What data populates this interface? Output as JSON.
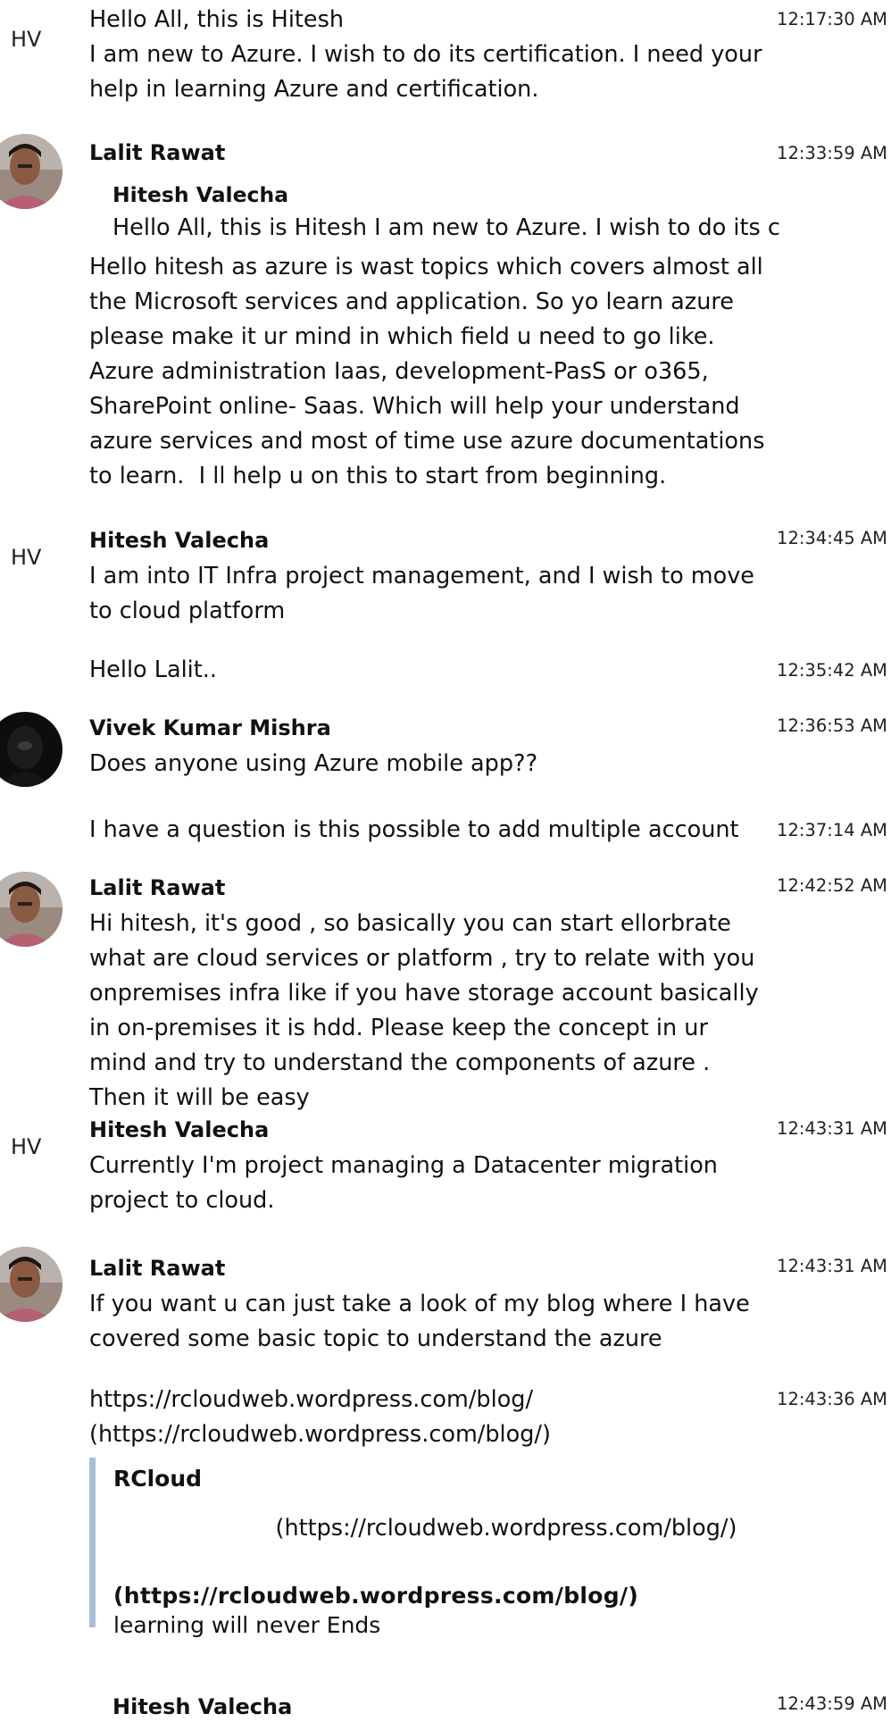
{
  "messages": [
    {
      "avatar": "HV",
      "sender": "",
      "time": "12:17:30 AM",
      "text": "Hello All, this is Hitesh\nI am new to Azure. I wish to do its certification. I need your help in learning Azure and certification."
    },
    {
      "avatar": "photo",
      "sender": "Lalit Rawat",
      "time": "12:33:59 AM",
      "quote": {
        "name": "Hitesh Valecha",
        "text": "Hello All, this is Hitesh I am new to Azure. I wish to do its c"
      },
      "text": "Hello hitesh as azure is wast topics which covers almost all the Microsoft services and application. So yo learn azure please make it ur mind in which field u need to go like. Azure administration Iaas, development-PasS or o365, SharePoint online- Saas. Which will help your understand azure services and most of time use azure documentations to learn.  I ll help u on this to start from beginning."
    },
    {
      "avatar": "HV",
      "sender": "Hitesh Valecha",
      "time": "12:34:45 AM",
      "text": "I am into IT Infra project management, and I wish to move to cloud platform"
    },
    {
      "avatar": "",
      "sender": "",
      "time": "12:35:42 AM",
      "text": "Hello Lalit.."
    },
    {
      "avatar": "photo-dark",
      "sender": "Vivek Kumar Mishra",
      "time": "12:36:53 AM",
      "text": "Does anyone using Azure mobile app??"
    },
    {
      "avatar": "",
      "sender": "",
      "time": "12:37:14 AM",
      "text": "I have a question is this possible to add multiple account"
    },
    {
      "avatar": "photo",
      "sender": "Lalit Rawat",
      "time": "12:42:52 AM",
      "text": "Hi hitesh, it's good , so basically you can start ellorbrate what are cloud services or platform , try to relate with you onpremises infra like if you have storage account basically in on-premises it is hdd. Please keep the concept in ur mind and try to understand the components of azure . Then it will be easy"
    },
    {
      "avatar": "HV",
      "sender": "Hitesh Valecha",
      "time": "12:43:31 AM",
      "text": "Currently I'm project managing a Datacenter migration project to cloud."
    },
    {
      "avatar": "photo",
      "sender": "Lalit Rawat",
      "time": "12:43:31 AM",
      "text": "If you want u can just take a look of my blog where I have covered some basic topic to understand the azure"
    },
    {
      "avatar": "",
      "sender": "",
      "time": "12:43:36 AM",
      "text": "https://rcloudweb.wordpress.com/blog/\n(https://rcloudweb.wordpress.com/blog/)"
    },
    {
      "avatar": "",
      "sender": "Hitesh Valecha",
      "time": "12:43:59 AM",
      "text": ""
    }
  ],
  "link_preview": {
    "title": "RCloud",
    "center_link": "(https://rcloudweb.wordpress.com/blog/)",
    "bold_link": "(https://rcloudweb.wordpress.com/blog/)",
    "description": "learning will never Ends"
  },
  "colors": {
    "quote_bar": "#a8bfd6"
  }
}
